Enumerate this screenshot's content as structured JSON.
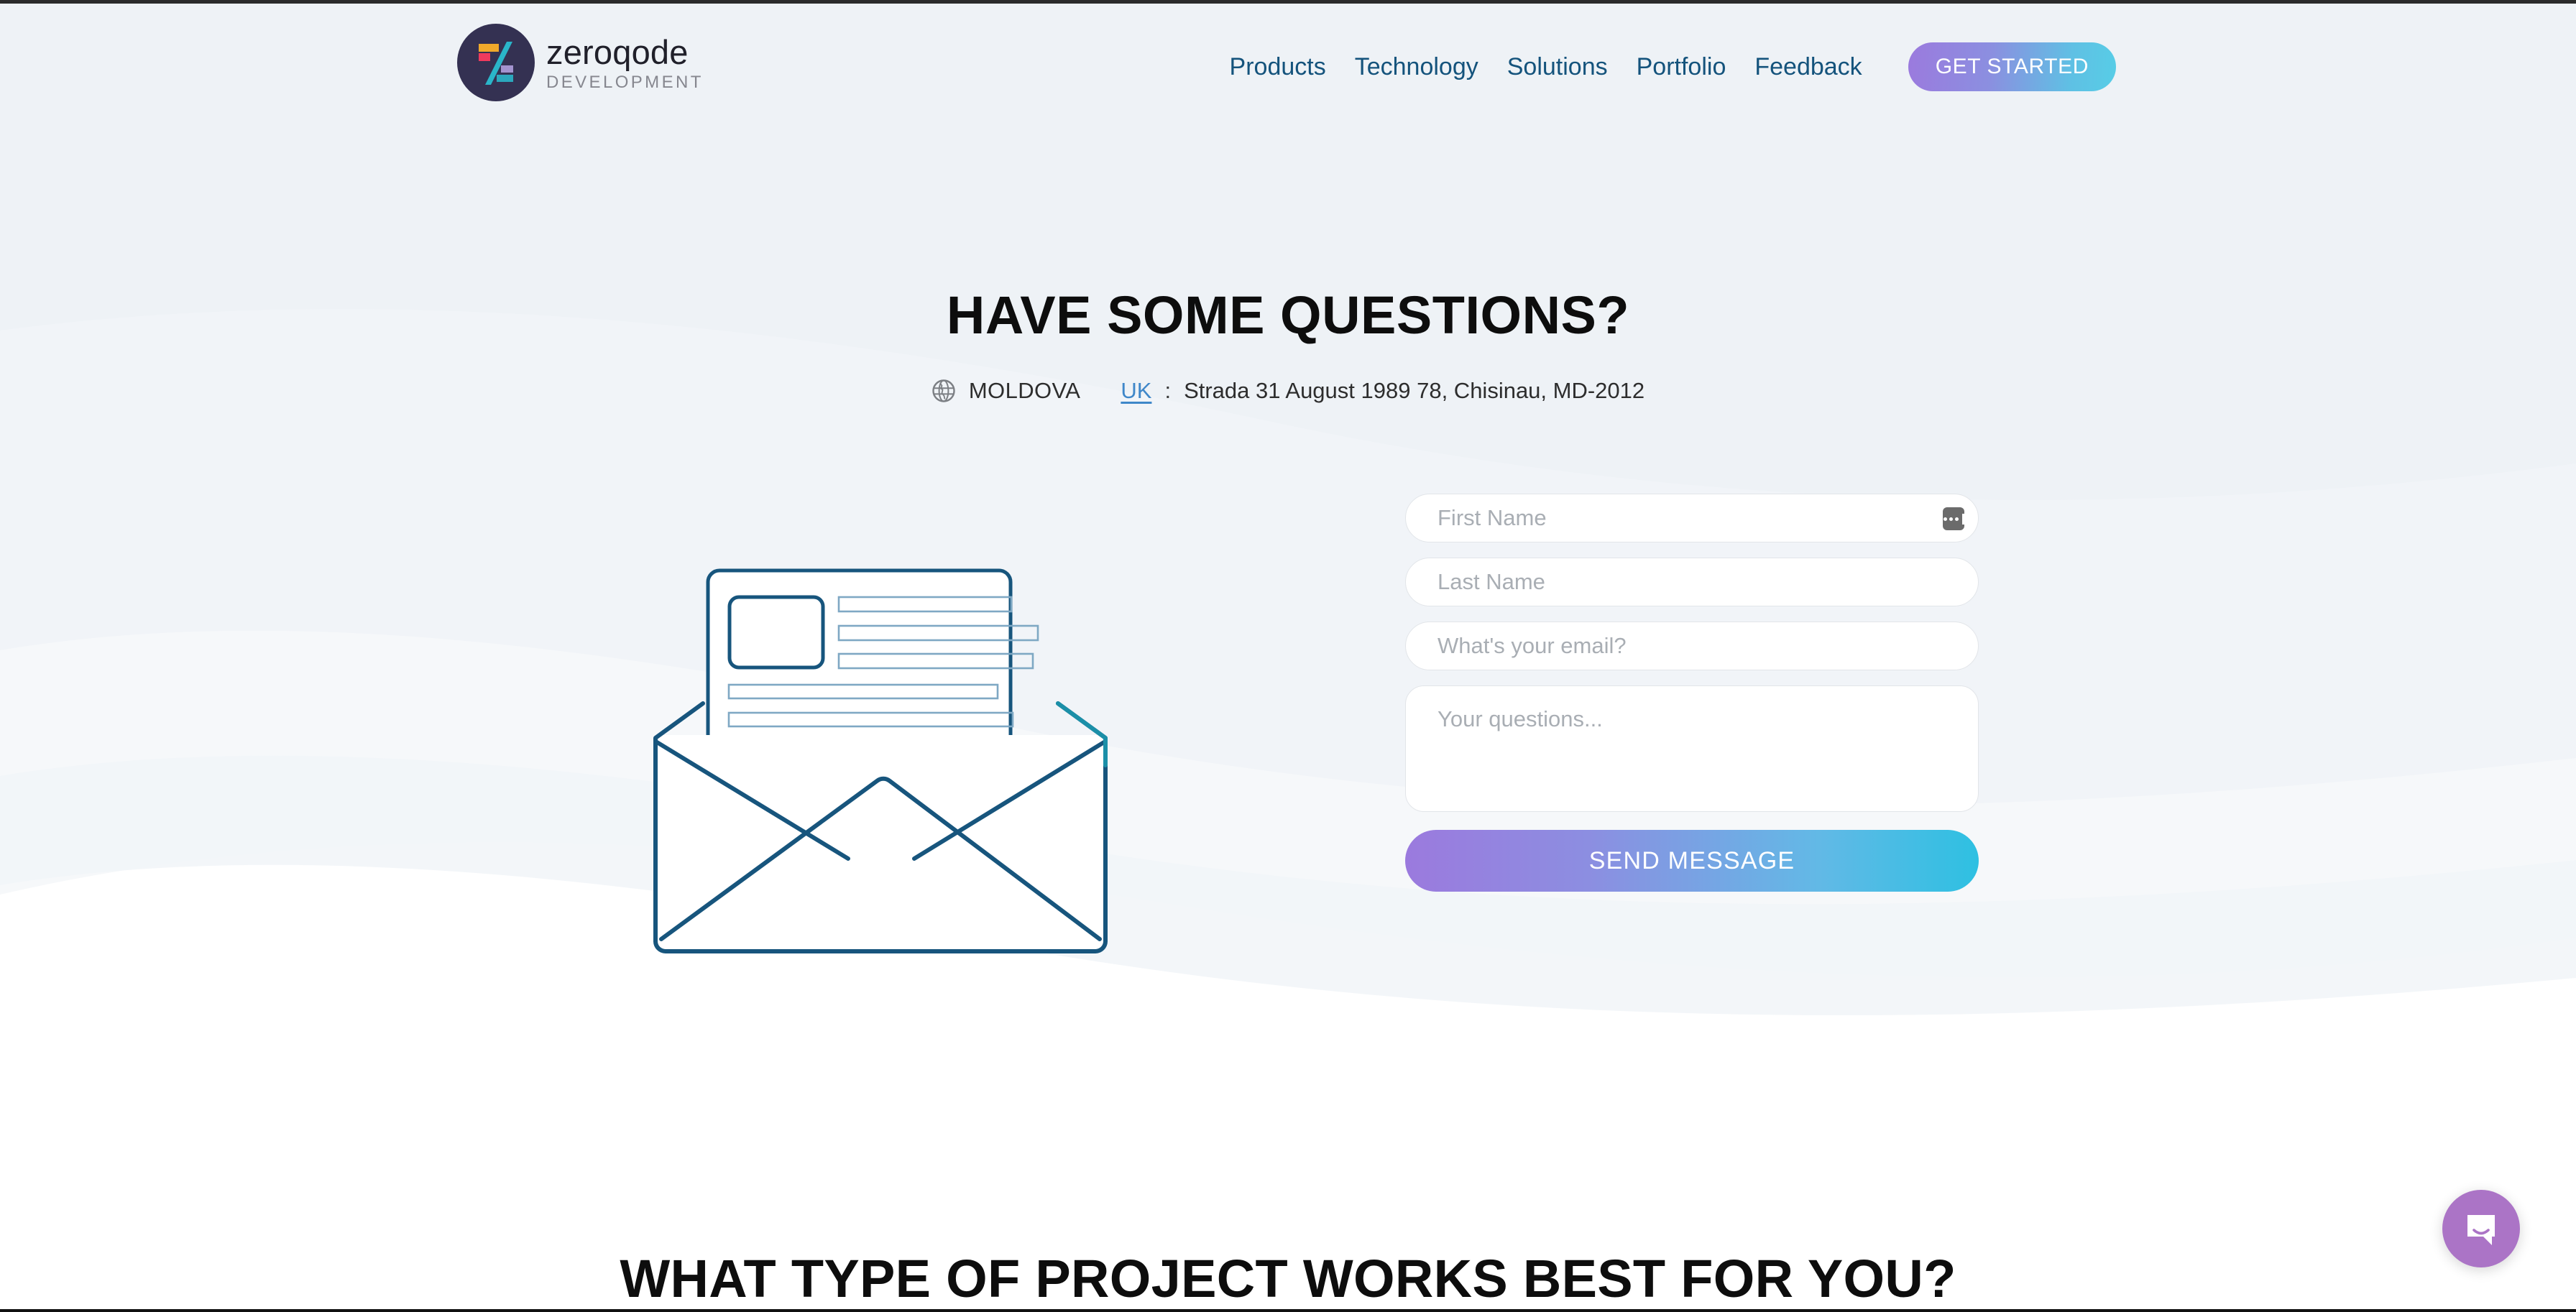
{
  "brand": {
    "name": "zeroqode",
    "subtitle": "DEVELOPMENT",
    "logo_icon": "zeroqode-logo-icon",
    "colors": {
      "circle": "#343152",
      "bar_orange": "#f0a92b",
      "bar_red": "#ef3a5d",
      "slash_cyan": "#2ab5c9",
      "bar_purple": "#a393cf",
      "bar_teal": "#2ba8bd"
    }
  },
  "nav": {
    "links": [
      {
        "label": "Products"
      },
      {
        "label": "Technology"
      },
      {
        "label": "Solutions"
      },
      {
        "label": "Portfolio"
      },
      {
        "label": "Feedback"
      }
    ],
    "cta_label": "GET STARTED",
    "link_color": "#14537c",
    "cta_gradient_from": "#9b7ade",
    "cta_gradient_to": "#57cde6"
  },
  "hero": {
    "title": "HAVE SOME QUESTIONS?",
    "location": {
      "globe_icon": "globe-icon",
      "country": "MOLDOVA",
      "alt_country_link": "UK",
      "separator": ":",
      "address": "Strada 31 August 1989 78, Chisinau, MD-2012",
      "link_color": "#3f87c9"
    }
  },
  "illustration": {
    "name": "open-envelope-with-letter-illustration",
    "stroke_dark": "#17557d",
    "stroke_light": "#7fa8c4",
    "stroke_teal": "#1b8fa8"
  },
  "form": {
    "fields": [
      {
        "name": "first-name-input",
        "placeholder": "First Name",
        "value": "",
        "type": "text"
      },
      {
        "name": "last-name-input",
        "placeholder": "Last Name",
        "value": "",
        "type": "text"
      },
      {
        "name": "email-input",
        "placeholder": "What's your email?",
        "value": "",
        "type": "text"
      },
      {
        "name": "questions-textarea",
        "placeholder": "Your questions...",
        "value": "",
        "type": "textarea"
      }
    ],
    "autofill_badge_icon": "password-manager-autofill-icon",
    "submit_label": "SEND MESSAGE",
    "submit_gradient_from": "#9b7ade",
    "submit_gradient_to": "#2ec0e2"
  },
  "section_projects": {
    "title": "WHAT TYPE OF PROJECT WORKS BEST FOR YOU?"
  },
  "chat": {
    "launcher_icon": "chat-bubble-icon",
    "color": "#ab74c6"
  },
  "theme": {
    "page_background": "#eef2f6",
    "wave_light": "#f3f6f9",
    "wave_white": "#ffffff"
  }
}
